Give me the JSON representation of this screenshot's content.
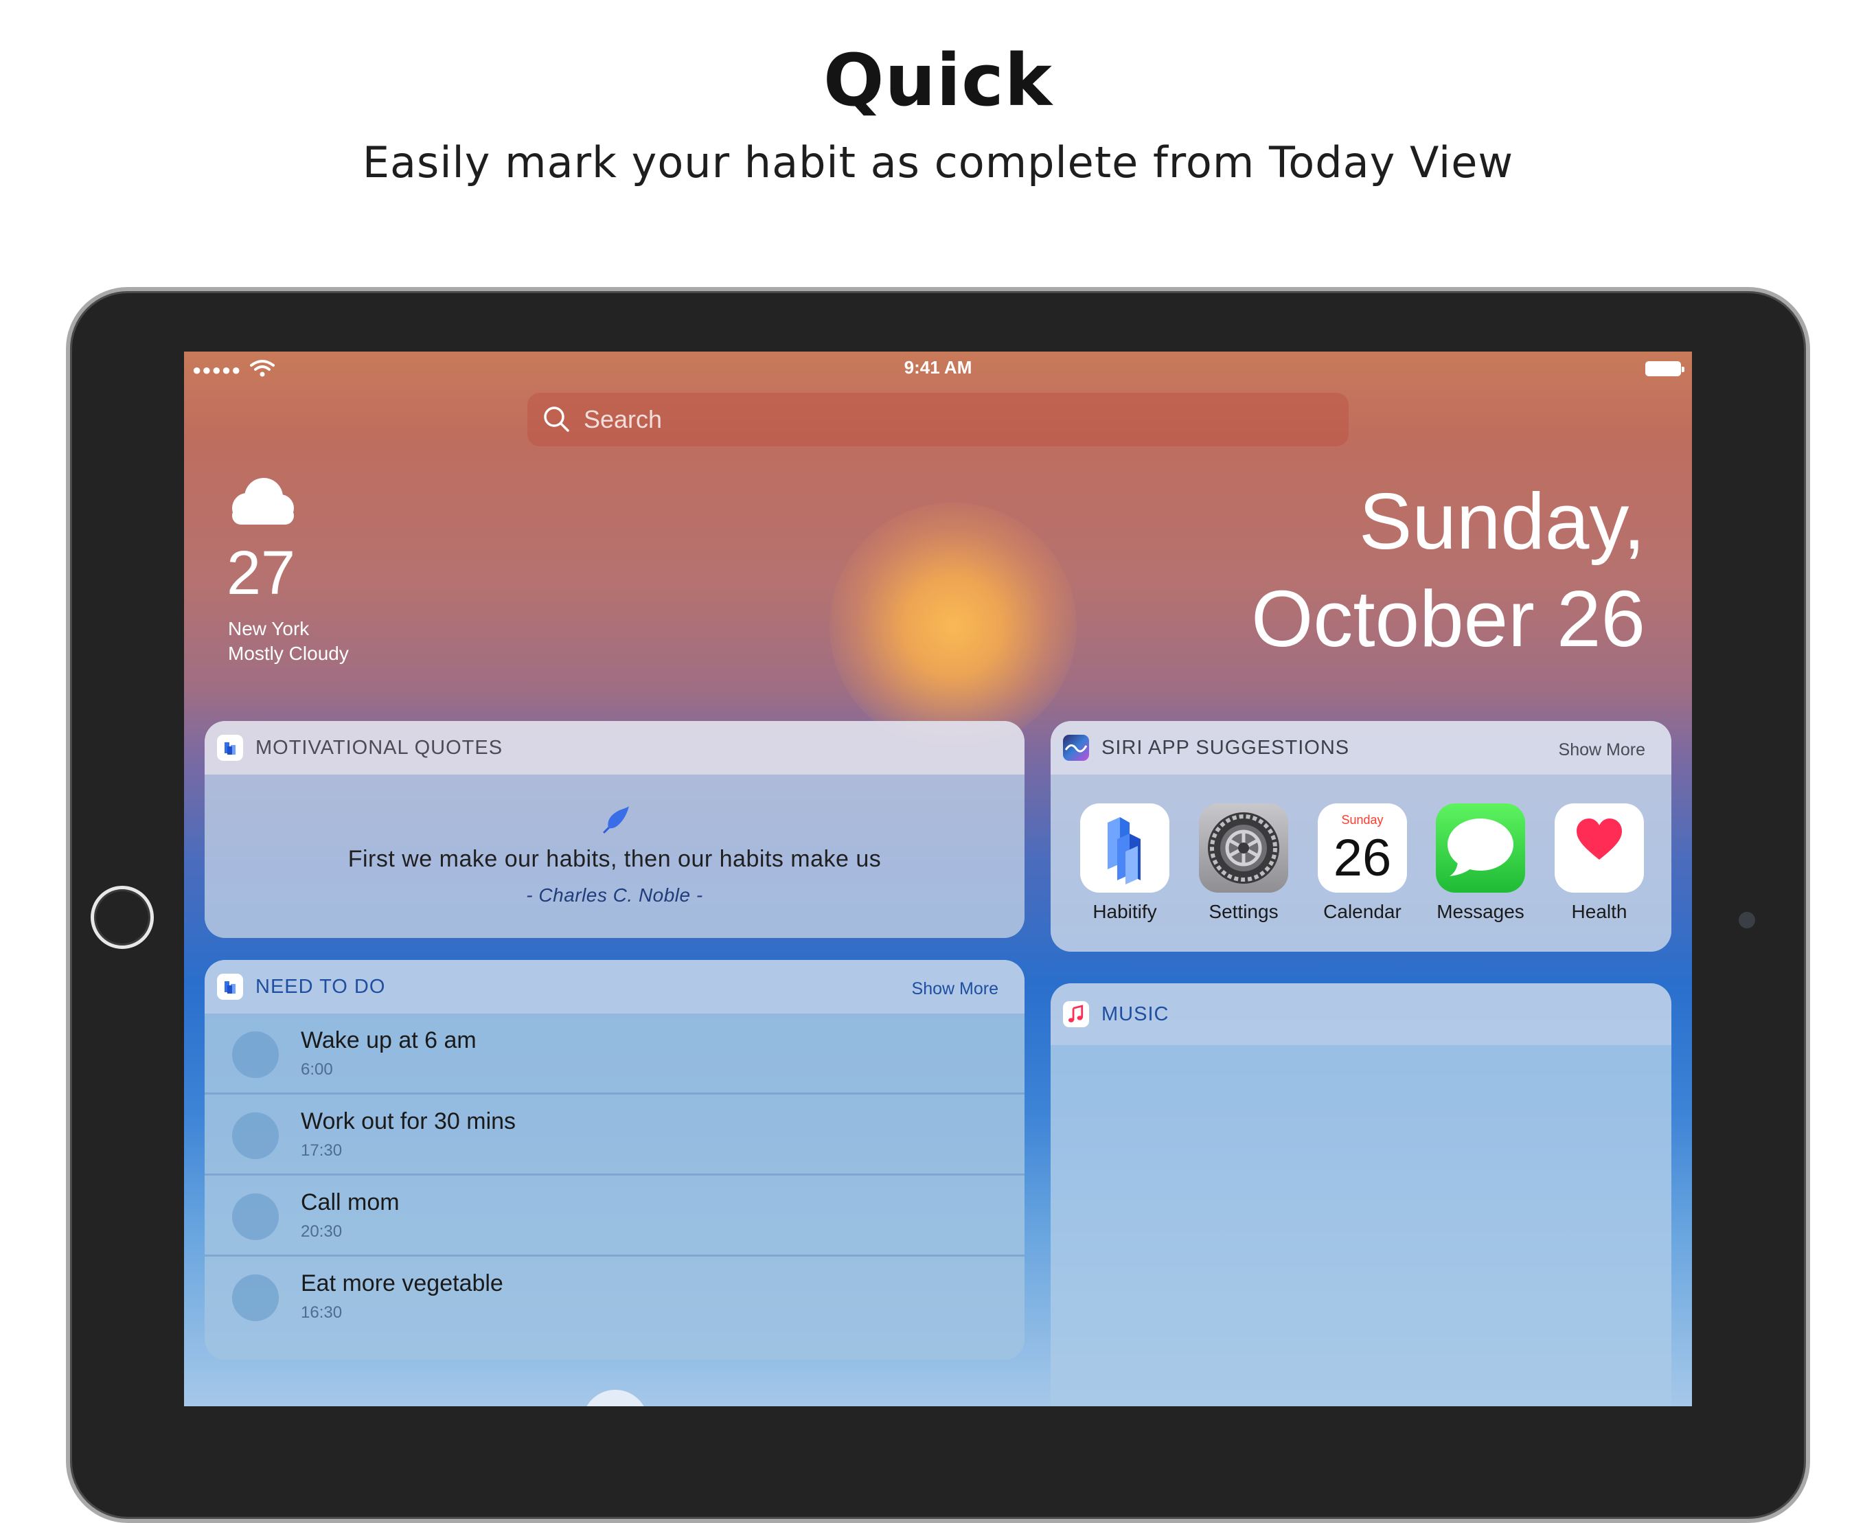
{
  "hero": {
    "title": "Quick",
    "subtitle": "Easily mark your habit as complete from Today View"
  },
  "status_bar": {
    "signal": "●●●●●",
    "time": "9:41 AM"
  },
  "search": {
    "placeholder": "Search"
  },
  "weather": {
    "icon": "cloud-icon",
    "temperature": "27",
    "city": "New York",
    "condition": "Mostly  Cloudy"
  },
  "date": {
    "line1": "Sunday,",
    "line2": "October 26"
  },
  "quotes_widget": {
    "title": "MOTIVATIONAL QUOTES",
    "quote": "First we make our habits, then our habits make us",
    "author": "- Charles C. Noble -"
  },
  "siri_widget": {
    "title": "SIRI APP SUGGESTIONS",
    "show_more": "Show More",
    "apps": [
      {
        "label": "Habitify"
      },
      {
        "label": "Settings"
      },
      {
        "label": "Calendar",
        "day": "Sunday",
        "date": "26"
      },
      {
        "label": "Messages"
      },
      {
        "label": "Health"
      }
    ]
  },
  "todo_widget": {
    "title": "NEED TO DO",
    "show_more": "Show More",
    "items": [
      {
        "title": "Wake up at 6 am",
        "time": "6:00"
      },
      {
        "title": "Work out for 30 mins",
        "time": "17:30"
      },
      {
        "title": "Call mom",
        "time": "20:30"
      },
      {
        "title": "Eat more vegetable",
        "time": "16:30"
      }
    ]
  },
  "music_widget": {
    "title": "MUSIC"
  },
  "colors": {
    "accent_blue": "#1f4fa0",
    "messages_green": "#2fc64a",
    "health_red": "#ff2d55",
    "habitify_blue": "#2f6fe8"
  }
}
